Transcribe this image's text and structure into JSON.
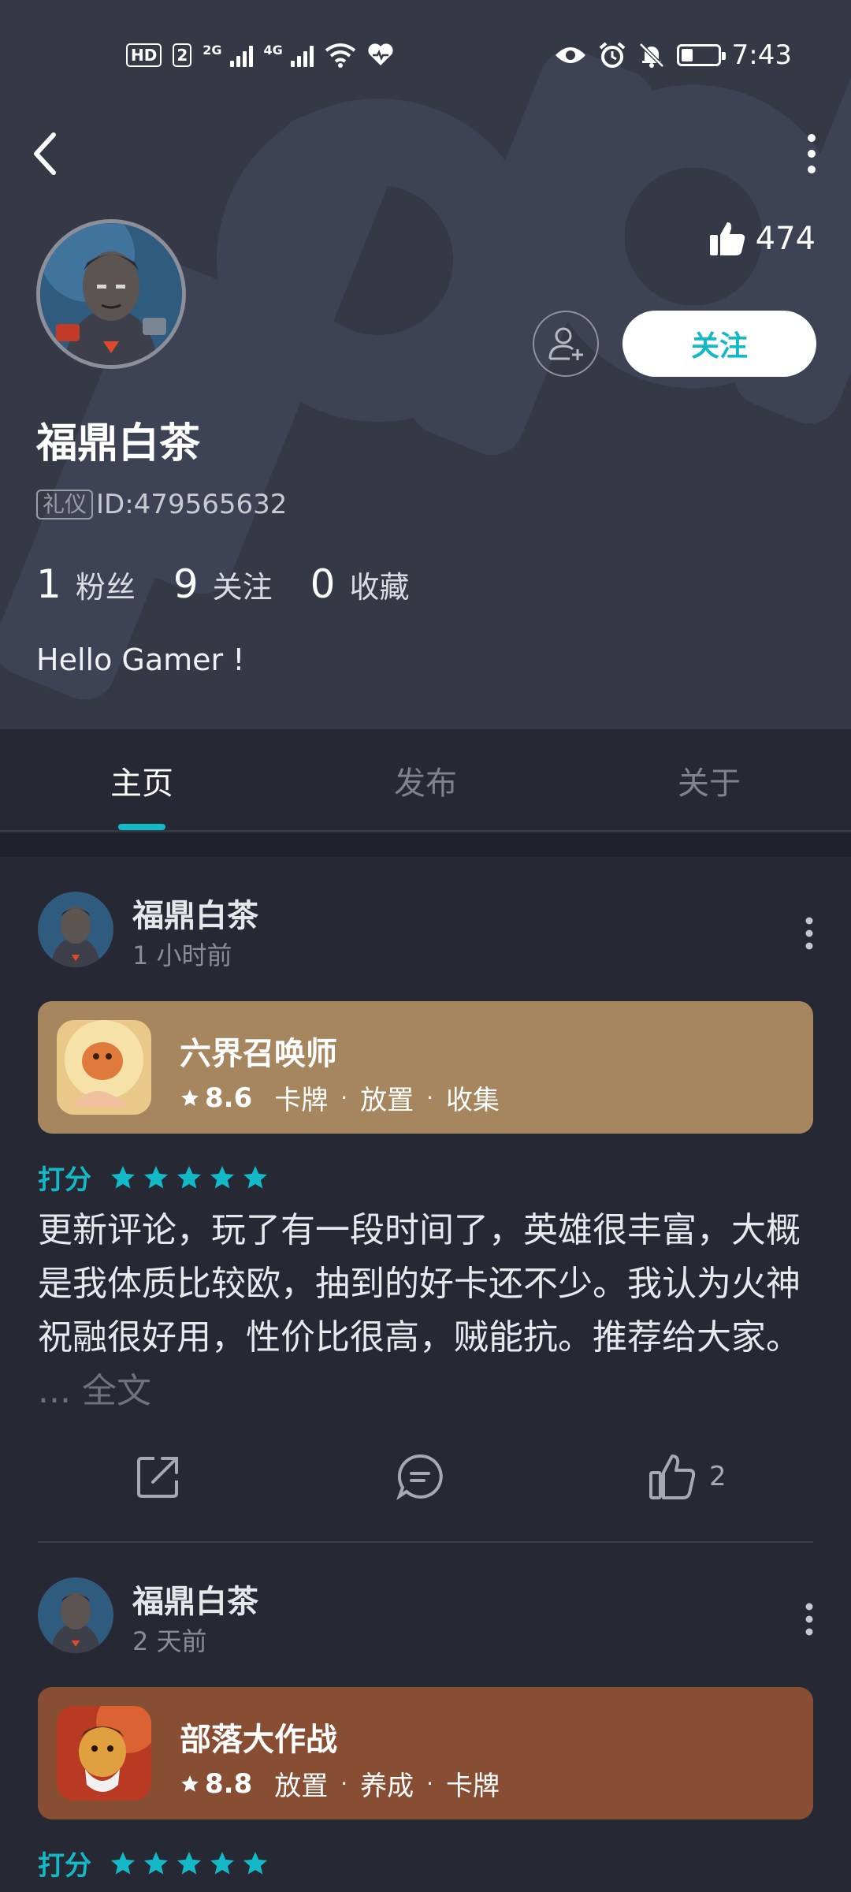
{
  "status_bar": {
    "hd_label": "HD",
    "sim_label": "2",
    "net1_label": "2G",
    "net2_label": "4G",
    "time": "7:43",
    "icons": [
      "eye-icon",
      "alarm-icon",
      "mute-bell-icon",
      "battery-icon"
    ]
  },
  "profile": {
    "likes": "474",
    "follow_label": "关注",
    "name": "福鼎白茶",
    "badge": "礼仪",
    "id_text": "ID:479565632",
    "stats": [
      {
        "value": "1",
        "label": "粉丝"
      },
      {
        "value": "9",
        "label": "关注"
      },
      {
        "value": "0",
        "label": "收藏"
      }
    ],
    "bio": "Hello Gamer !"
  },
  "tabs": [
    {
      "label": "主页",
      "active": true
    },
    {
      "label": "发布",
      "active": false
    },
    {
      "label": "关于",
      "active": false
    }
  ],
  "colors": {
    "accent": "#14b9c8",
    "header_bg": "#353946",
    "page_bg": "#262833",
    "game1_card": "#a5865e",
    "game2_card": "#874e33"
  },
  "posts": [
    {
      "author": "福鼎白茶",
      "time": "1 小时前",
      "game": {
        "title": "六界召唤师",
        "score": "8.6",
        "tags": [
          "卡牌",
          "放置",
          "收集"
        ]
      },
      "rating_label": "打分",
      "stars": 5,
      "text": "更新评论，玩了有一段时间了，英雄很丰富，大概是我体质比较欧，抽到的好卡还不少。我认为火神祝融很好用，性价比很高，贼能抗。推荐给大家。",
      "read_more": "... 全文",
      "like_count": "2"
    },
    {
      "author": "福鼎白茶",
      "time": "2 天前",
      "game": {
        "title": "部落大作战",
        "score": "8.8",
        "tags": [
          "放置",
          "养成",
          "卡牌"
        ]
      },
      "rating_label": "打分",
      "stars": 5
    }
  ]
}
